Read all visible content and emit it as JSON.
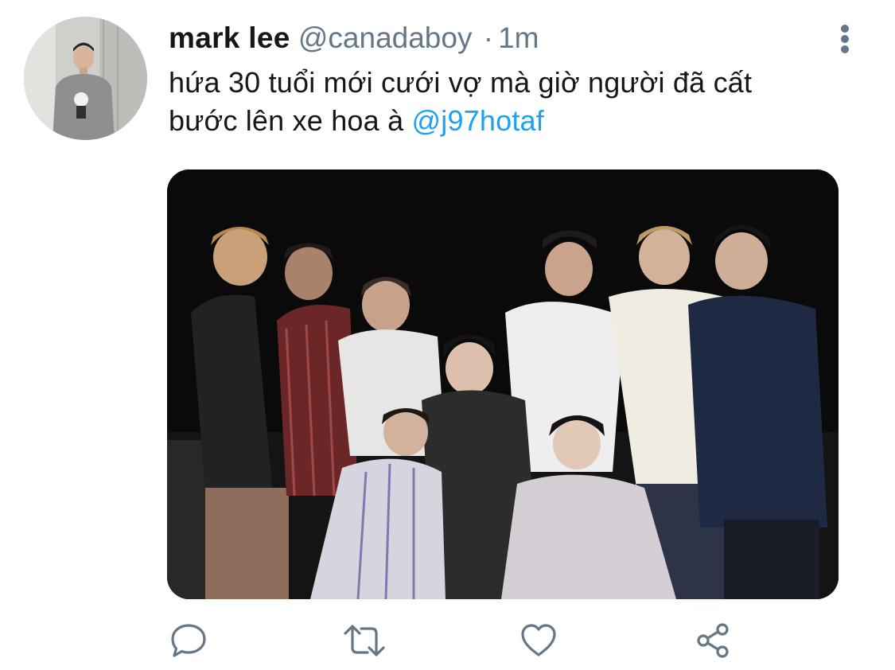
{
  "tweet": {
    "display_name": "mark lee",
    "handle": "@canadaboy",
    "separator": "·",
    "time": "1m",
    "text": "hứa 30 tuổi mới cưới vợ mà giờ người đã cất bước lên xe hoa à ",
    "mention": "@j97hotaf"
  },
  "colors": {
    "text": "#14171a",
    "muted": "#657786",
    "link": "#1da1f2",
    "background": "#ffffff"
  },
  "icons": {
    "more": "more-vertical-icon",
    "reply": "reply-icon",
    "retweet": "retweet-icon",
    "like": "heart-icon",
    "share": "share-icon"
  }
}
